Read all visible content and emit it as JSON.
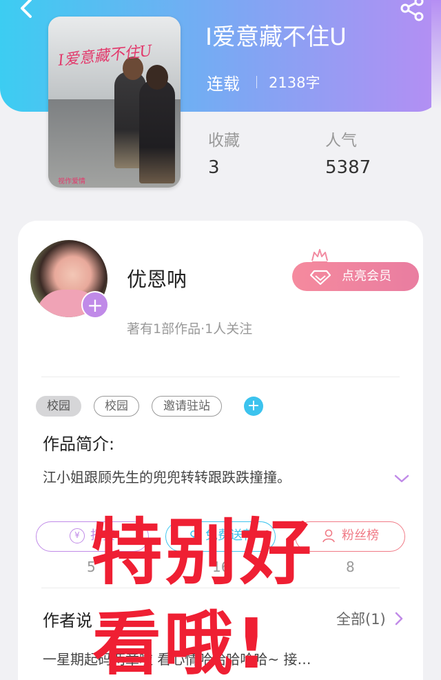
{
  "book": {
    "title": "I爱意藏不住U",
    "status": "连载",
    "word_count": "2138字",
    "cover_title": "I爱意藏不住U",
    "cover_tag": "视作爱情"
  },
  "stats": {
    "favorites_label": "收藏",
    "favorites_value": "3",
    "popularity_label": "人气",
    "popularity_value": "5387"
  },
  "author": {
    "name": "优恩呐",
    "meta": "著有1部作品·1人关注",
    "follow_symbol": "+"
  },
  "vip": {
    "label": "点亮会员"
  },
  "tags": [
    {
      "label": "校园",
      "filled": true
    },
    {
      "label": "校园",
      "filled": false
    },
    {
      "label": "邀请驻站",
      "filled": false
    }
  ],
  "tag_add_symbol": "+",
  "intro": {
    "title": "作品简介:",
    "text": "江小姐跟顾先生的兜兜转转跟跌跌撞撞。"
  },
  "actions": [
    {
      "label": "打赏",
      "icon": "yen-icon",
      "icon_char": "¥",
      "count": "5",
      "color": "#c08ae8"
    },
    {
      "label": "免费送花",
      "icon": "flower-icon",
      "icon_char": "",
      "count": "16",
      "color": "#3cc3ee"
    },
    {
      "label": "粉丝榜",
      "icon": "fans-icon",
      "icon_char": "",
      "count": "8",
      "color": "#f07a86"
    }
  ],
  "author_says": {
    "title": "作者说",
    "all_label": "全部(1)",
    "text": "一星期起码两章啦 看心情哈哈哈哈哈~ 接…"
  },
  "overlay": {
    "line1": "特别好",
    "line2": "看哦!"
  },
  "colors": {
    "header_start": "#3ccdf2",
    "header_end": "#b58ef3",
    "vip_pink": "#f58a9e",
    "overlay_red": "#ef1f33"
  }
}
